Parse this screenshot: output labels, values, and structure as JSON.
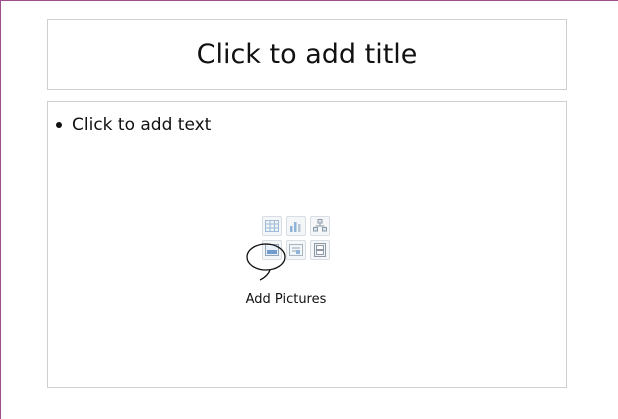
{
  "slide": {
    "title_placeholder": "Click to add title",
    "body_placeholder": "Click to add text",
    "tooltip": "Add Pictures"
  },
  "content_icons": [
    {
      "name": "table-icon"
    },
    {
      "name": "chart-icon"
    },
    {
      "name": "smartart-icon"
    },
    {
      "name": "picture-icon"
    },
    {
      "name": "clip-art-icon"
    },
    {
      "name": "media-icon"
    }
  ],
  "colors": {
    "slide_border": "#9b4f8e",
    "placeholder_border": "#cfcfcf",
    "icon_blue": "#8fb3d9",
    "icon_gray": "#9aa3ad"
  }
}
